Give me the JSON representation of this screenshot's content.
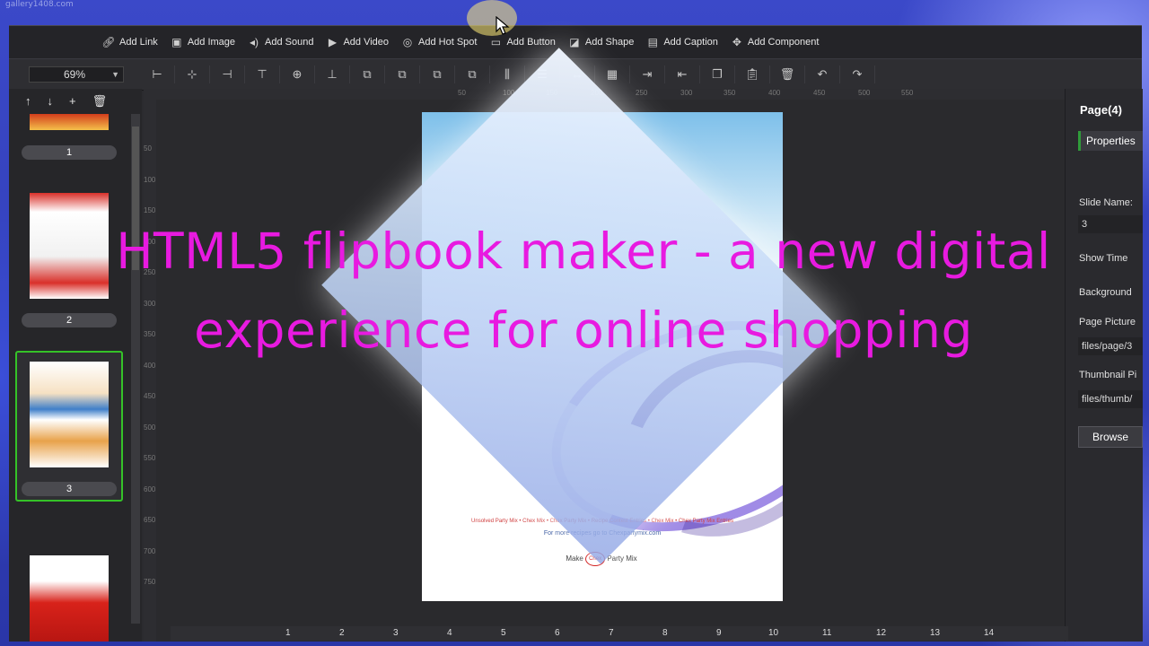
{
  "watermark": "gallery1408.com",
  "toolbar": {
    "buttons": [
      {
        "label": "Add Link",
        "icon": "link-icon"
      },
      {
        "label": "Add Image",
        "icon": "image-icon"
      },
      {
        "label": "Add Sound",
        "icon": "sound-icon"
      },
      {
        "label": "Add Video",
        "icon": "video-icon"
      },
      {
        "label": "Add Hot Spot",
        "icon": "hotspot-icon"
      },
      {
        "label": "Add Button",
        "icon": "button-icon"
      },
      {
        "label": "Add Shape",
        "icon": "shape-icon"
      },
      {
        "label": "Add Caption",
        "icon": "caption-icon"
      },
      {
        "label": "Add Component",
        "icon": "puzzle-icon"
      }
    ]
  },
  "zoom": {
    "value": "69%"
  },
  "left_panel": {
    "pages": [
      "1",
      "2",
      "3"
    ],
    "selected_page": "3"
  },
  "ruler_top_labels": [
    "0",
    "50",
    "100",
    "150",
    "200",
    "250",
    "300",
    "350",
    "400",
    "450",
    "500",
    "550"
  ],
  "ruler_left_labels": [
    "50",
    "100",
    "150",
    "200",
    "250",
    "300",
    "350",
    "400",
    "450",
    "500",
    "550",
    "600",
    "650",
    "700",
    "750"
  ],
  "ruler_bottom_labels": [
    "1",
    "2",
    "3",
    "4",
    "5",
    "6",
    "7",
    "8",
    "9",
    "10",
    "11",
    "12",
    "13",
    "14"
  ],
  "page_content": {
    "line1": "Unsolved Party Mix • Chex Mix • Chex Party Mix • Recipe Contest Entries • Chex Mix • Chex Party Mix Entries",
    "line2": "For more recipes go to Chexpartymix.com",
    "logo_text_left": "Make",
    "logo_badge": "Chex",
    "logo_text_right": "Party Mix"
  },
  "right_panel": {
    "title": "Page(4)",
    "tab": "Properties",
    "slide_name_label": "Slide Name:",
    "slide_name_value": "3",
    "show_time_label": "Show Time",
    "background_label": "Background",
    "page_picture_label": "Page Picture",
    "page_picture_value": "files/page/3",
    "thumbnail_label": "Thumbnail Pi",
    "thumbnail_value": "files/thumb/",
    "browse_label": "Browse"
  },
  "headline": {
    "line1": "HTML5 flipbook maker - a new digital",
    "line2": "experience for online shopping",
    "color": "#e81ae0"
  },
  "colors": {
    "selection_border": "#35c228",
    "app_bg": "#2b2b2f",
    "frame_blue": "#3b49c9"
  }
}
